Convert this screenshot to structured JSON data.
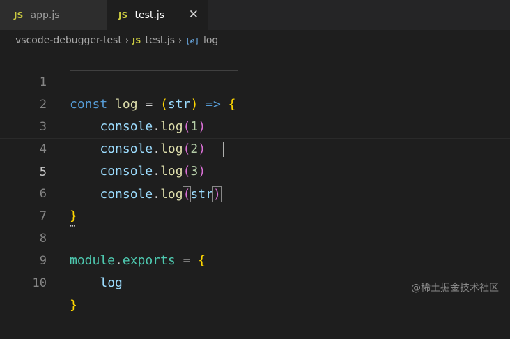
{
  "tabs": [
    {
      "icon": "JS",
      "label": "app.js",
      "active": false
    },
    {
      "icon": "JS",
      "label": "test.js",
      "active": true
    }
  ],
  "close_glyph": "✕",
  "breadcrumb": {
    "folder": "vscode-debugger-test",
    "file_icon": "JS",
    "file": "test.js",
    "symbol_icon": "[ℯ]",
    "symbol": "log"
  },
  "gutter": [
    "1",
    "2",
    "3",
    "4",
    "5",
    "6",
    "7",
    "8",
    "9",
    "10"
  ],
  "code": {
    "l1": {
      "kw": "const",
      "name": "log",
      "eq": "=",
      "p_open": "(",
      "param": "str",
      "p_close": ")",
      "arrow": "=>",
      "brace": "{"
    },
    "l2": {
      "obj": "console",
      "dot": ".",
      "fn": "log",
      "open": "(",
      "arg": "1",
      "close": ")"
    },
    "l3": {
      "obj": "console",
      "dot": ".",
      "fn": "log",
      "open": "(",
      "arg": "2",
      "close": ")"
    },
    "l4": {
      "obj": "console",
      "dot": ".",
      "fn": "log",
      "open": "(",
      "arg": "3",
      "close": ")"
    },
    "l5": {
      "obj": "console",
      "dot": ".",
      "fn": "log",
      "open": "(",
      "arg": "str",
      "close": ")"
    },
    "l6": {
      "brace": "}"
    },
    "l8": {
      "obj": "module",
      "dot": ".",
      "prop": "exports",
      "eq": "=",
      "brace": "{"
    },
    "l9": {
      "name": "log"
    },
    "l10": {
      "brace": "}"
    }
  },
  "fold_dots": "⋯",
  "watermark": "@稀土掘金技术社区"
}
